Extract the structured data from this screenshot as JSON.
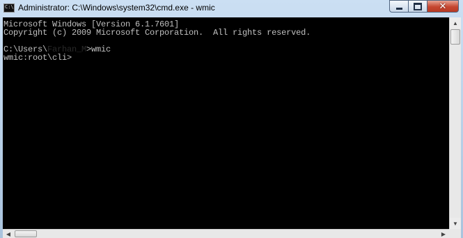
{
  "window": {
    "title": "Administrator: C:\\Windows\\system32\\cmd.exe - wmic",
    "app_icon_text": "C:\\",
    "controls": {
      "minimize": "minimize-icon",
      "maximize": "maximize-icon",
      "close": "close-icon"
    }
  },
  "console": {
    "line1": "Microsoft Windows [Version 6.1.7601]",
    "line2": "Copyright (c) 2009 Microsoft Corporation.  All rights reserved.",
    "line4_prefix": "C:\\Users\\",
    "line4_user": "Farhan_M",
    "line4_suffix": ">wmic",
    "line5": "wmic:root\\cli>"
  },
  "colors": {
    "console_background": "#000000",
    "console_text": "#c0c0c0",
    "close_button": "#c54630"
  }
}
